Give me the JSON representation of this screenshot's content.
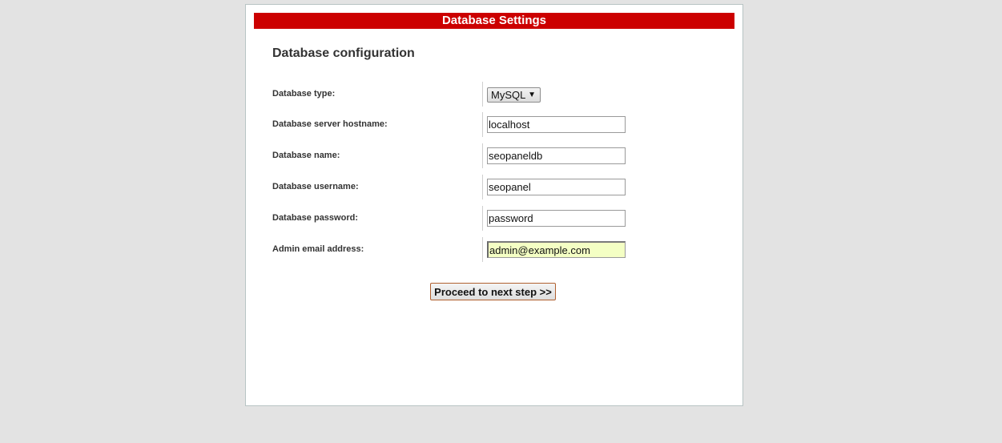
{
  "header": {
    "title": "Database Settings"
  },
  "section": {
    "title": "Database configuration"
  },
  "fields": {
    "db_type": {
      "label": "Database type:",
      "selected": "MySQL"
    },
    "db_host": {
      "label": "Database server hostname:",
      "value": "localhost"
    },
    "db_name": {
      "label": "Database name:",
      "value": "seopaneldb"
    },
    "db_user": {
      "label": "Database username:",
      "value": "seopanel"
    },
    "db_password": {
      "label": "Database password:",
      "value": "password"
    },
    "admin_email": {
      "label": "Admin email address:",
      "value": "admin@example.com"
    }
  },
  "actions": {
    "proceed_label": "Proceed to next step >>"
  },
  "colors": {
    "header_bg": "#cc0000",
    "page_bg": "#e3e3e3",
    "focused_input_bg": "#f4ffc4"
  },
  "icons": {
    "select_arrow": "chevron-down-icon"
  }
}
